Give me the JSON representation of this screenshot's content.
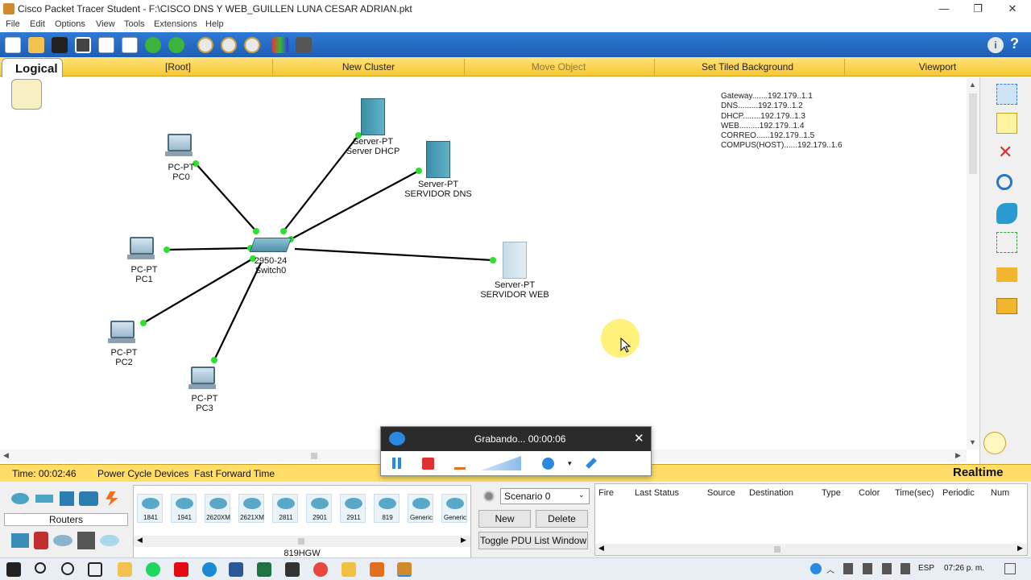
{
  "window": {
    "title": "Cisco Packet Tracer Student - F:\\CISCO DNS Y WEB_GUILLEN LUNA CESAR ADRIAN.pkt",
    "controls": {
      "minimize": "—",
      "restore": "❐",
      "close": "✕"
    }
  },
  "menu": [
    "File",
    "Edit",
    "Options",
    "View",
    "Tools",
    "Extensions",
    "Help"
  ],
  "toolbar": {
    "icons": [
      "new-file-icon",
      "open-folder-icon",
      "save-icon",
      "print-icon",
      "wizard-icon",
      "copy-icon",
      "paste-icon",
      "undo-icon",
      "redo-icon",
      "zoom-in-icon",
      "zoom-reset-icon",
      "zoom-out-icon",
      "palette-icon",
      "custom-device-icon"
    ],
    "info": "i",
    "help": "?"
  },
  "workspace_bar": {
    "tab": "Logical",
    "items": [
      "[Root]",
      "New Cluster",
      "Move Object",
      "Set Tiled Background",
      "Viewport"
    ]
  },
  "devices": {
    "pc0": {
      "type": "PC-PT",
      "name": "PC0"
    },
    "pc1": {
      "type": "PC-PT",
      "name": "PC1"
    },
    "pc2": {
      "type": "PC-PT",
      "name": "PC2"
    },
    "pc3": {
      "type": "PC-PT",
      "name": "PC3"
    },
    "switch0": {
      "type": "2950-24",
      "name": "Switch0"
    },
    "server_dhcp": {
      "type": "Server-PT",
      "name": "Server DHCP"
    },
    "server_dns": {
      "type": "Server-PT",
      "name": "SERVIDOR DNS"
    },
    "server_web": {
      "type": "Server-PT",
      "name": "SERVIDOR WEB"
    }
  },
  "ip_note": [
    "Gateway.......192.179..1.1",
    "DNS.........192.179..1.2",
    "DHCP........192.179..1.3",
    "WEB.........192.179..1.4",
    "CORREO......192.179..1.5",
    "COMPUS(HOST)......192.179..1.6"
  ],
  "right_panel": {
    "icons": [
      "select-icon",
      "note-icon",
      "delete-icon",
      "inspect-icon",
      "draw-shape-icon",
      "resize-icon",
      "add-simple-pdu-icon",
      "add-complex-pdu-icon"
    ]
  },
  "status": {
    "time": "Time: 00:02:46",
    "power_cycle": "Power Cycle Devices",
    "fast_forward": "Fast Forward Time",
    "mode": "Realtime"
  },
  "recorder": {
    "status": "Grabando... 00:00:06",
    "close": "✕"
  },
  "device_panel": {
    "category": "Routers",
    "models": [
      "1841",
      "1941",
      "2620XM",
      "2621XM",
      "2811",
      "2901",
      "2911",
      "819",
      "Generic",
      "Generic"
    ],
    "selected_model": "819HGW"
  },
  "scenario": {
    "selected": "Scenario 0",
    "new": "New",
    "delete": "Delete",
    "toggle": "Toggle PDU List Window"
  },
  "pdu_table": {
    "columns": [
      "Fire",
      "Last Status",
      "Source",
      "Destination",
      "Type",
      "Color",
      "Time(sec)",
      "Periodic",
      "Num"
    ]
  },
  "taskbar": {
    "lang": "ESP",
    "clock": "07:26 p. m."
  },
  "colors": {
    "toolbar_blue": "#1e5fb4",
    "workspace_yellow": "#f7c832",
    "link_green": "#2ee02e",
    "recorder_dark": "#2b2b2b"
  }
}
